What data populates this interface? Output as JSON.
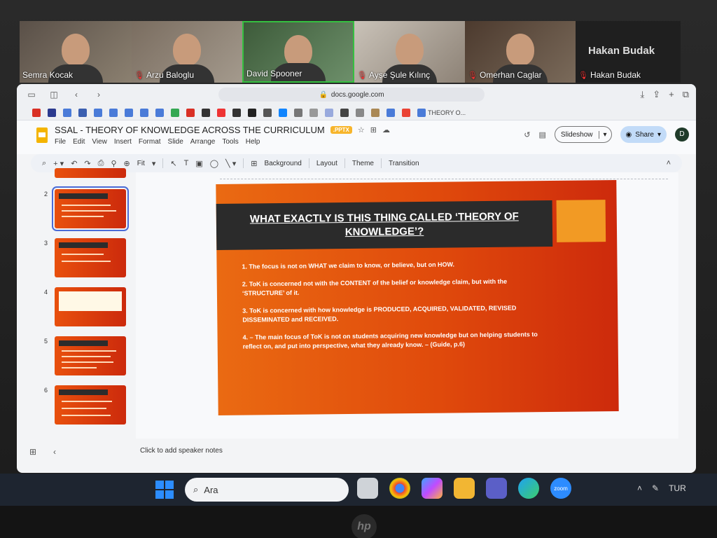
{
  "zoom": {
    "participants": [
      {
        "name": "Semra Kocak",
        "muted": false
      },
      {
        "name": "Arzu Baloglu",
        "muted": true
      },
      {
        "name": "David Spooner",
        "muted": false
      },
      {
        "name": "Ayşe Şule Kılınç",
        "muted": true
      },
      {
        "name": "Omerhan Caglar",
        "muted": true
      },
      {
        "name": "Hakan Budak",
        "muted": true
      }
    ],
    "big_name": "Hakan Budak"
  },
  "browser": {
    "url": "docs.google.com",
    "bookmark_last": "THEORY O..."
  },
  "doc": {
    "title": "SSAL - THEORY OF KNOWLEDGE ACROSS THE CURRICULUM",
    "badge": ".PPTX",
    "menu": [
      "File",
      "Edit",
      "View",
      "Insert",
      "Format",
      "Slide",
      "Arrange",
      "Tools",
      "Help"
    ],
    "slideshow_label": "Slideshow",
    "share_label": "Share",
    "avatar_letter": "D"
  },
  "toolbar": {
    "zoom": "Fit",
    "background": "Background",
    "layout": "Layout",
    "theme": "Theme",
    "transition": "Transition"
  },
  "filmstrip": {
    "numbers": [
      "2",
      "3",
      "4",
      "5",
      "6"
    ]
  },
  "slide": {
    "title": "WHAT EXACTLY IS THIS THING CALLED ‘THEORY OF KNOWLEDGE’?",
    "points": [
      "1. The focus is not on WHAT we claim to know, or believe, but on HOW.",
      "2. ToK is concerned not with the CONTENT of the belief or knowledge claim, but with the ‘STRUCTURE’ of it.",
      "3. ToK is concerned with how knowledge is PRODUCED, ACQUIRED, VALIDATED, REVISED DISSEMINATED and RECEIVED.",
      "4. – The main focus of ToK is not on students acquiring new knowledge but on helping students to reflect on, and put into perspective, what they already know. – (Guide, p.6)"
    ]
  },
  "speaker_notes": "Click to add speaker notes",
  "taskbar": {
    "search_placeholder": "Ara",
    "language": "TUR",
    "zoom_app": "zoom"
  },
  "colors": {
    "slide_orange": "#e04a0c",
    "title_bar": "#2b2b2b",
    "accent": "#f29a24",
    "share_blue": "#c2dbf8"
  }
}
